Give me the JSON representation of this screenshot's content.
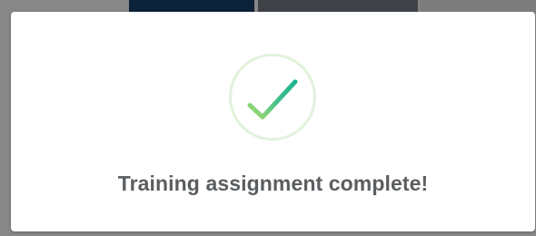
{
  "dialog": {
    "message": "Training assignment complete!",
    "icon": "checkmark-success-icon"
  },
  "colors": {
    "ring": "#e1f2dc",
    "check_start": "#a6dd73",
    "check_end": "#1fb38f",
    "text": "#5b5e61",
    "overlay": "#878787"
  }
}
